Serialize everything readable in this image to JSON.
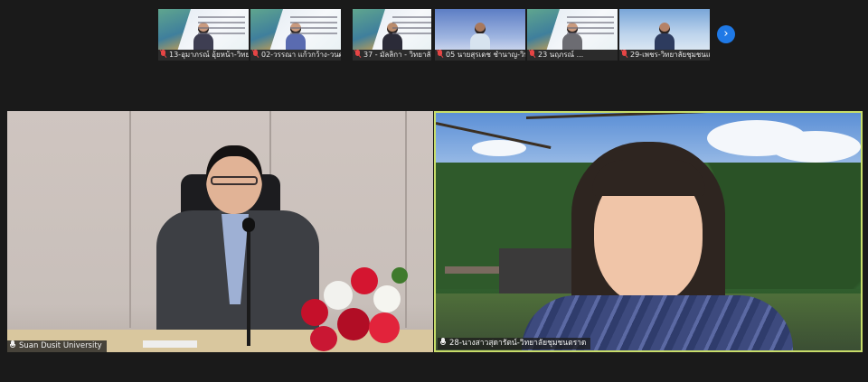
{
  "participants_strip": [
    {
      "name": "13-อุมาภรณ์ อุ้ยหน้า-วิทย...",
      "muted": true,
      "background": "slide"
    },
    {
      "name": "02-วรรณา แก้วกว้าง-วนศ...",
      "muted": true,
      "background": "slide"
    },
    {
      "name": "37 - มัลลิกา - วิทยาลัยชุม...",
      "muted": true,
      "background": "slide"
    },
    {
      "name": "05 นายสุรเดช ชำนาญ-วิท...",
      "muted": true,
      "background": "blue-sky"
    },
    {
      "name": "23 นฤภรณ์ ...",
      "muted": true,
      "background": "slide"
    },
    {
      "name": "29-เพชร-วิทยาลัยชุมชนแ...",
      "muted": true,
      "background": "palm"
    }
  ],
  "next_button_icon": "chevron-right-icon",
  "main_tiles": {
    "left": {
      "name": "Suan Dusit University",
      "mic_icon": "microphone-icon"
    },
    "right": {
      "name": "28-นางสาวสุดารัตน์-วิทยาลัยชุมชนตราด",
      "mic_icon": "microphone-icon",
      "active_speaker": true
    }
  },
  "colors": {
    "background": "#1a1a1a",
    "active_speaker_border": "#c8dd6a",
    "next_button": "#1f79e6",
    "muted_mic": "#e64545"
  }
}
